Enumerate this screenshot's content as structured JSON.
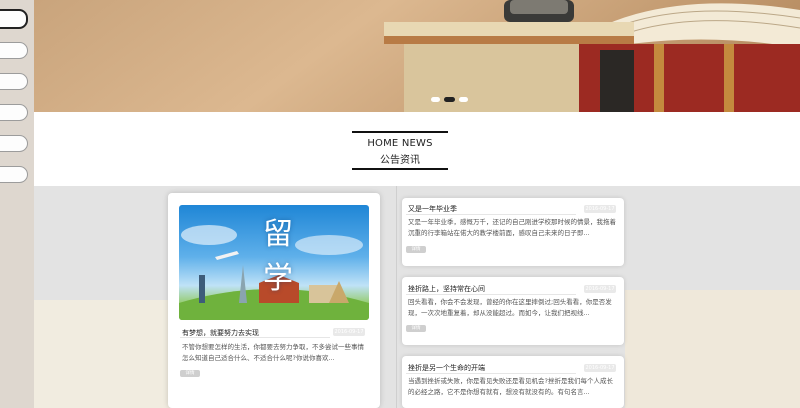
{
  "section": {
    "title_en": "HOME NEWS",
    "title_zh": "公告资讯"
  },
  "feature": {
    "image_text": "留学",
    "title": "有梦想，就要努力去实现",
    "date": "2016-09-17",
    "desc": "不管你想要怎样的生活，你都要去努力争取，不多尝试一些事情怎么知道自己适合什么、不适合什么呢?你说你喜欢...",
    "more": "详情"
  },
  "news": [
    {
      "title": "又是一年毕业季",
      "date": "2016-09-17",
      "desc": "又是一年毕业季，感慨万千，还记的自己刚进学校那时候的情景，我拖着沉重的行李箱站在偌大的教学楼前面，感叹自己未来的日子即...",
      "more": "详情"
    },
    {
      "title": "挫折路上，坚持常在心间",
      "date": "2016-09-17",
      "desc": "回头看看，你会不会发现，曾经的你在这里摔倒过;回头看看，你是否发现，一次次地重复着，却从没能超过。而如今，让我们把视线...",
      "more": "详情"
    },
    {
      "title": "挫折是另一个生命的开端",
      "date": "2016-09-17",
      "desc": "当遇到挫折或失败，你是看见失败还是看见机会?挫折是我们每个人成长的必经之路，它不是你想有就有，想没有就没有的。有句名言...",
      "more": "详情"
    }
  ],
  "colors": {
    "accent": "#111111",
    "page_bg": "#e3e3e3"
  }
}
